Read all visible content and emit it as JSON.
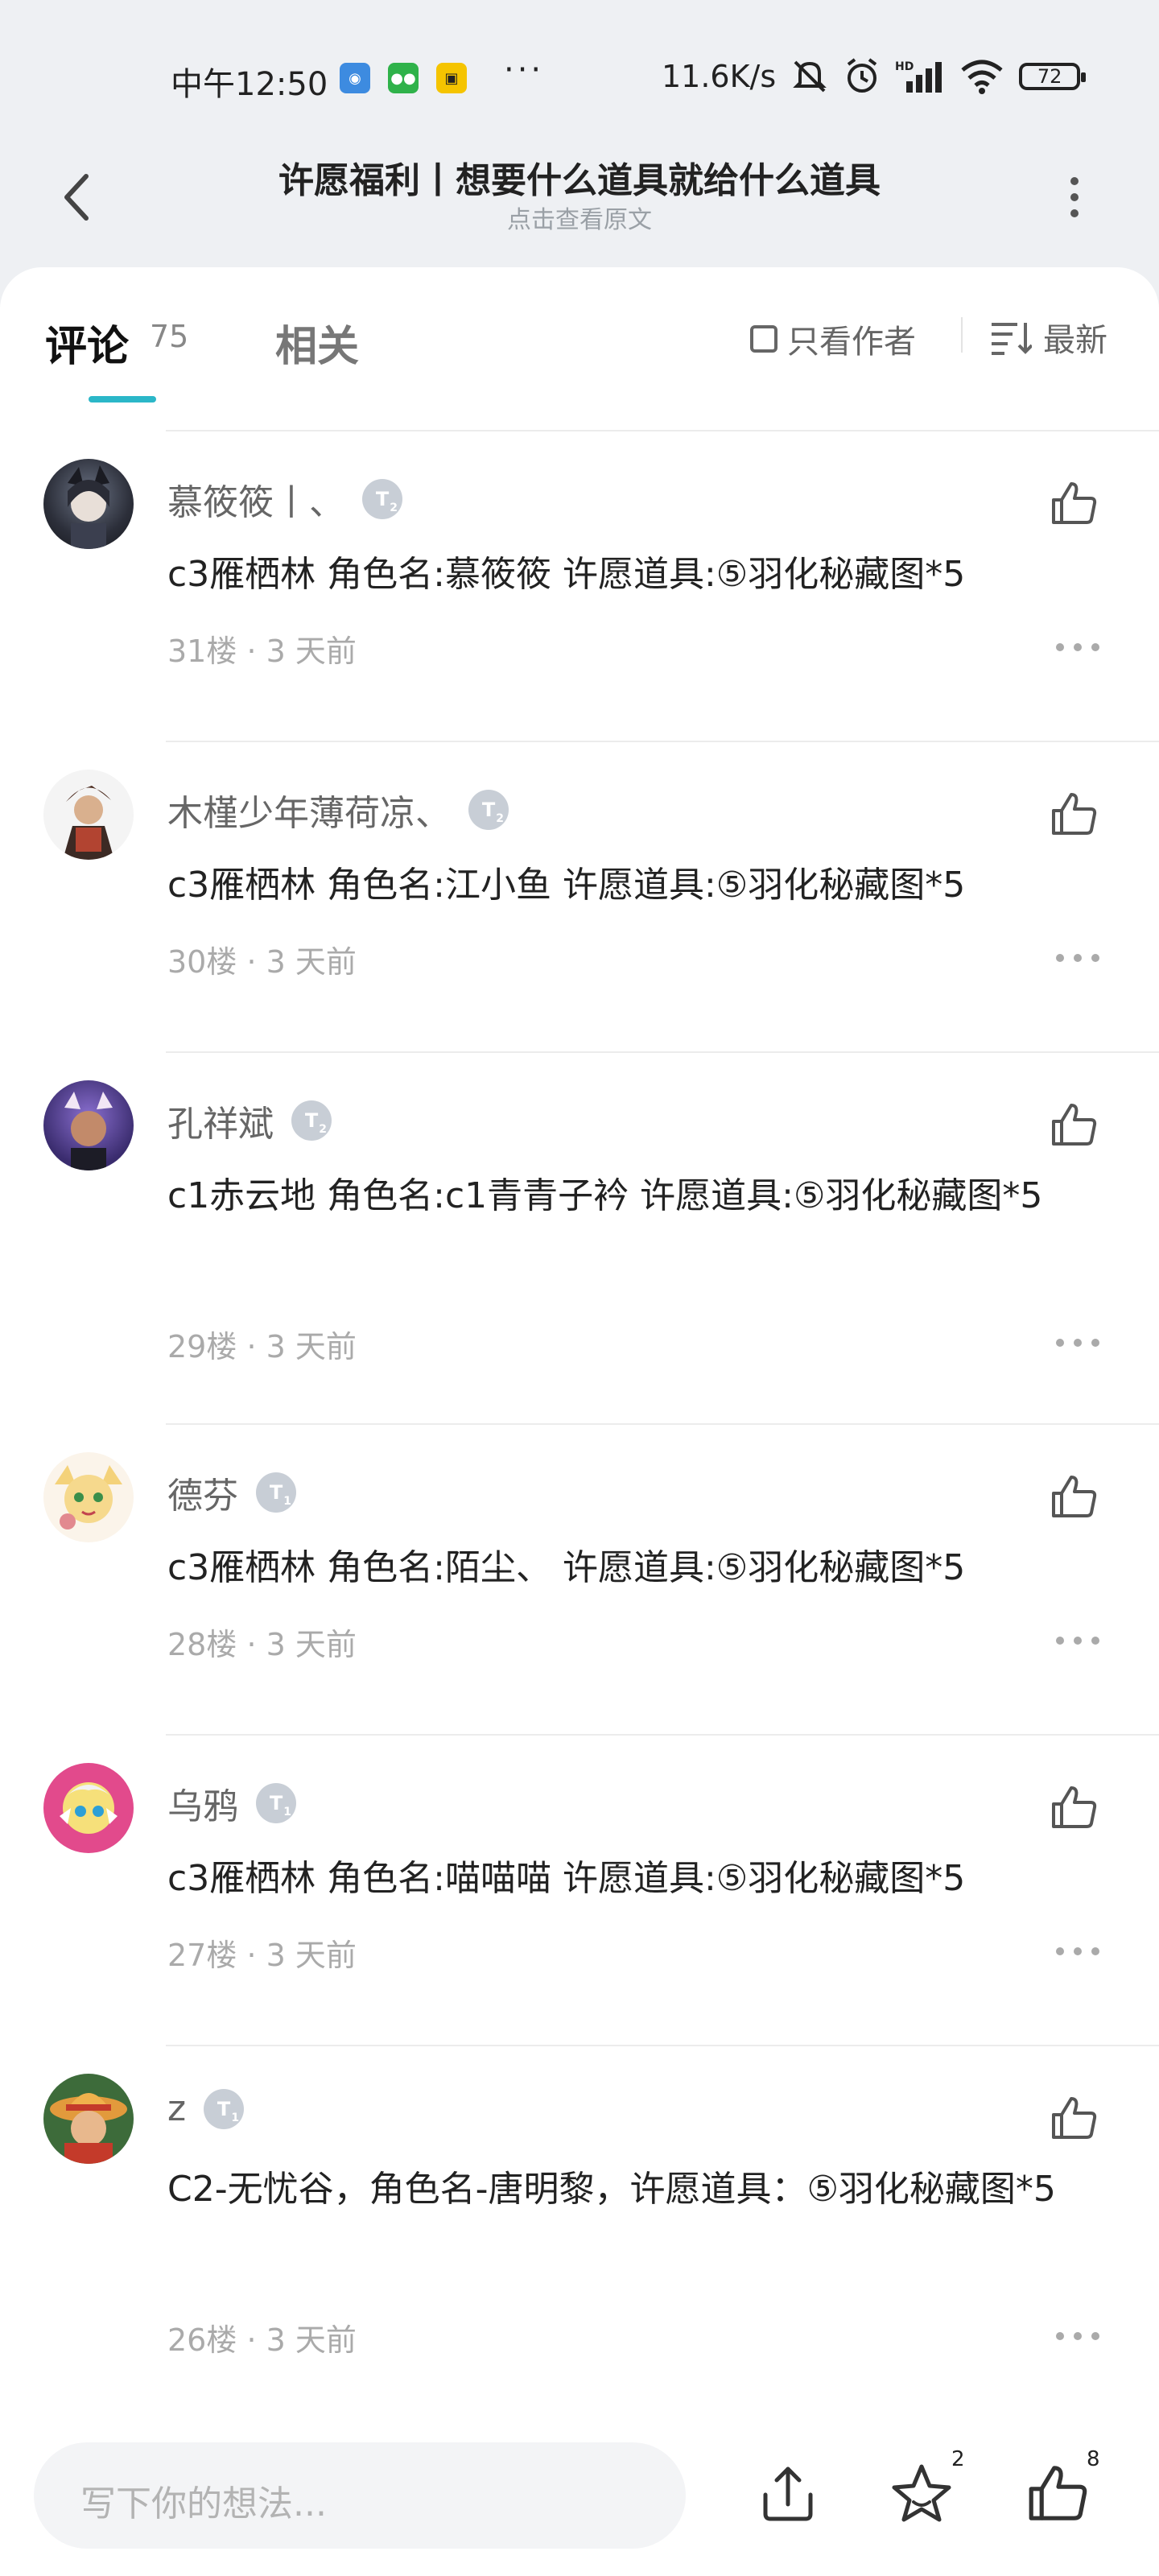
{
  "status_bar": {
    "time": "中午12:50",
    "app_icons": [
      "browser-icon",
      "wechat-icon",
      "taobao-icon"
    ],
    "more": "···",
    "speed": "11.6K/s",
    "status_icons": [
      "mute-icon",
      "alarm-icon",
      "hd-signal-icon",
      "wifi-icon"
    ],
    "battery": "72"
  },
  "header": {
    "title": "许愿福利丨想要什么道具就给什么道具",
    "subtitle": "点击查看原文"
  },
  "tabs": {
    "comments_label": "评论",
    "comments_count": "75",
    "related_label": "相关",
    "author_only_label": "只看作者",
    "sort_label": "最新"
  },
  "comments": [
    {
      "name": "慕筱筱丨、",
      "level": "2",
      "text": "c3雁栖林 角色名:慕筱筱   许愿道具:⑤羽化秘藏图*5",
      "floor": "31楼",
      "time": "3 天前"
    },
    {
      "name": "木槿少年薄荷凉、",
      "level": "2",
      "text": "c3雁栖林 角色名:江小鱼   许愿道具:⑤羽化秘藏图*5",
      "floor": "30楼",
      "time": "3 天前"
    },
    {
      "name": "孔祥斌",
      "level": "2",
      "text": "c1赤云地 角色名:c1青青子衿  许愿道具:⑤羽化秘藏图*5",
      "floor": "29楼",
      "time": "3 天前"
    },
    {
      "name": "德芬",
      "level": "1",
      "text": "c3雁栖林 角色名:陌尘、  许愿道具:⑤羽化秘藏图*5",
      "floor": "28楼",
      "time": "3 天前"
    },
    {
      "name": "乌鸦",
      "level": "1",
      "text": "c3雁栖林 角色名:喵喵喵 许愿道具:⑤羽化秘藏图*5",
      "floor": "27楼",
      "time": "3 天前"
    },
    {
      "name": "z",
      "level": "1",
      "text": "C2-无忧谷，角色名-唐明黎，许愿道具：⑤羽化秘藏图*5",
      "floor": "26楼",
      "time": "3 天前"
    }
  ],
  "bottom_bar": {
    "input_placeholder": "写下你的想法...",
    "favorite_count": "2",
    "like_count": "8"
  },
  "colors": {
    "accent": "#2bb7c8",
    "background": "#eef0f3",
    "level_badge": "#c8ced6"
  }
}
